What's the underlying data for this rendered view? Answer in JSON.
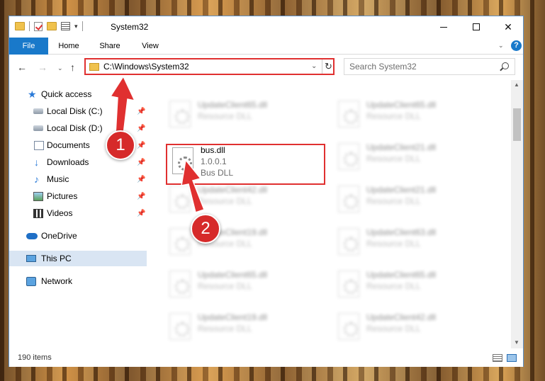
{
  "window": {
    "title": "System32",
    "controls": {
      "minimize": "minimize",
      "maximize": "maximize",
      "close": "✕"
    }
  },
  "ribbon": {
    "tabs": [
      {
        "label": "File"
      },
      {
        "label": "Home"
      },
      {
        "label": "Share"
      },
      {
        "label": "View"
      }
    ],
    "help": "?"
  },
  "address": {
    "path": "C:\\Windows\\System32",
    "search_placeholder": "Search System32"
  },
  "nav_pane": {
    "items": [
      {
        "label": "Quick access",
        "icon": "star-icon"
      },
      {
        "label": "Local Disk (C:)",
        "icon": "drive-icon",
        "pinned": true
      },
      {
        "label": "Local Disk (D:)",
        "icon": "drive-icon",
        "pinned": true
      },
      {
        "label": "Documents",
        "icon": "documents-icon",
        "pinned": true
      },
      {
        "label": "Downloads",
        "icon": "downloads-icon",
        "pinned": true
      },
      {
        "label": "Music",
        "icon": "music-icon",
        "pinned": true
      },
      {
        "label": "Pictures",
        "icon": "pictures-icon",
        "pinned": true
      },
      {
        "label": "Videos",
        "icon": "videos-icon",
        "pinned": true
      },
      {
        "label": "OneDrive",
        "icon": "onedrive-icon"
      },
      {
        "label": "This PC",
        "icon": "this-pc-icon",
        "selected": true
      },
      {
        "label": "Network",
        "icon": "network-icon"
      }
    ]
  },
  "files": {
    "highlighted": {
      "name": "bus.dll",
      "version": "1.0.0.1",
      "description": "Bus DLL"
    },
    "blurred": [
      {
        "name": "UpdateClient65.dll",
        "description": "Resource DLL"
      },
      {
        "name": "UpdateClient65.dll",
        "description": "Resource DLL"
      },
      {
        "name": "UpdateClient21.dll",
        "description": "Resource DLL"
      },
      {
        "name": "UpdateClient42.dll",
        "description": "Resource DLL"
      },
      {
        "name": "UpdateClient21.dll",
        "description": "Resource DLL"
      },
      {
        "name": "UpdateClient19.dll",
        "description": "Resource DLL"
      },
      {
        "name": "UpdateClient63.dll",
        "description": "Resource DLL"
      },
      {
        "name": "UpdateClient65.dll",
        "description": "Resource DLL"
      },
      {
        "name": "UpdateClient65.dll",
        "description": "Resource DLL"
      },
      {
        "name": "UpdateClient19.dll",
        "description": "Resource DLL"
      },
      {
        "name": "UpdateClient42.dll",
        "description": "Resource DLL"
      }
    ]
  },
  "status": {
    "item_count": "190 items"
  },
  "annotations": {
    "step1": "1",
    "step2": "2"
  },
  "colors": {
    "accent": "#1979ca",
    "annotation": "#e03030",
    "selection": "#d9e5f3"
  }
}
